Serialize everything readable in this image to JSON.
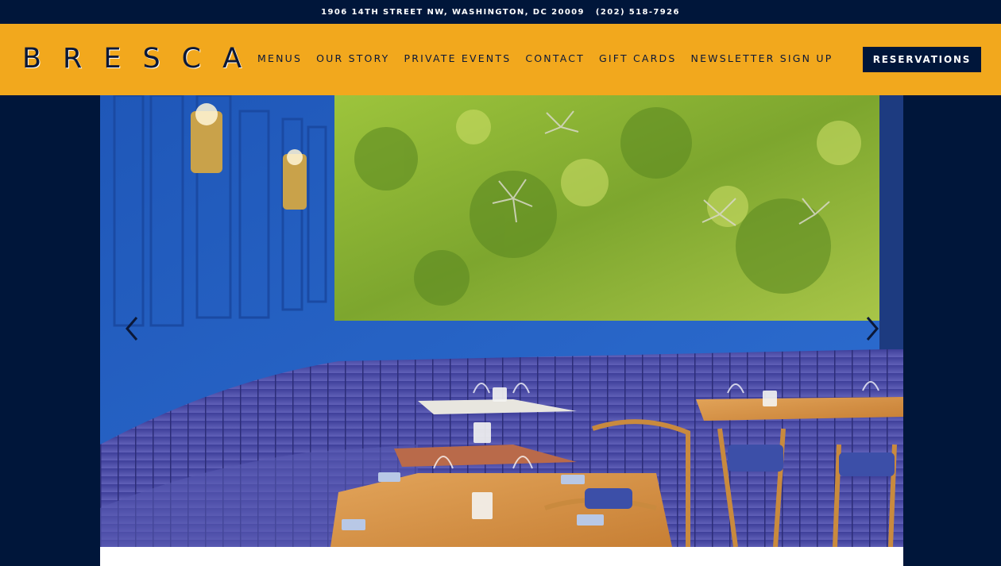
{
  "topbar": {
    "address": "1906 14TH STREET NW, WASHINGTON, DC 20009",
    "phone": "(202) 518-7926"
  },
  "header": {
    "logo_text": "BRESCA",
    "nav": [
      {
        "label": "MENUS"
      },
      {
        "label": "OUR STORY"
      },
      {
        "label": "PRIVATE EVENTS"
      },
      {
        "label": "CONTACT"
      },
      {
        "label": "GIFT CARDS"
      },
      {
        "label": "NEWSLETTER SIGN UP"
      }
    ],
    "reservations_label": "RESERVATIONS"
  },
  "colors": {
    "navy": "#00163a",
    "gold": "#f2a81d",
    "wall_blue": "#2b63c6",
    "moss_green": "#8fb838",
    "banquette_purple": "#4d4fa8",
    "wood": "#d99548"
  },
  "icons": {
    "prev": "chevron-left-icon",
    "next": "chevron-right-icon"
  }
}
